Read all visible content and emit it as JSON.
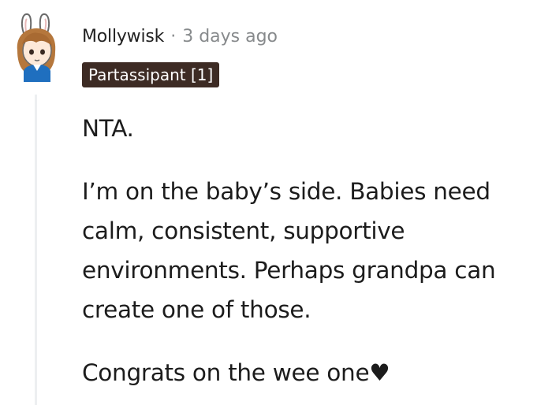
{
  "comment": {
    "author": "Mollywisk",
    "separator": "·",
    "timestamp": "3 days ago",
    "flair": "Partassipant [1]",
    "avatar_icon": "bunny-ears-avatar-icon",
    "paragraphs": [
      "NTA.",
      "I’m on the baby’s side. Babies need calm, consistent, supportive environments. Perhaps grandpa can create one of those.",
      "Congrats on the wee one♥"
    ]
  },
  "colors": {
    "flair_bg": "#3d2b24",
    "meta_gray": "#878a8c",
    "thread_line": "#edeff1"
  }
}
